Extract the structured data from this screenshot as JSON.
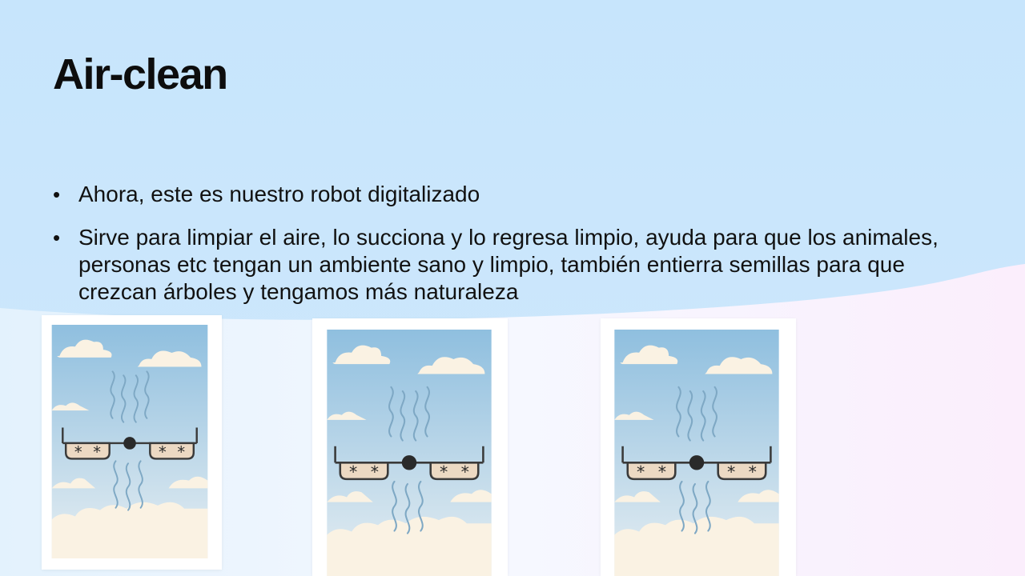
{
  "slide": {
    "title": "Air-clean",
    "bullets": [
      {
        "text": "Ahora, este es nuestro robot digitalizado"
      },
      {
        "text": "Sirve para limpiar el aire, lo succiona y lo regresa limpio, ayuda para que los animales, personas etc tengan un ambiente sano y limpio, también entierra semillas para que crezcan árboles y tengamos más naturaleza"
      }
    ],
    "bullet_glyph": "•"
  },
  "images": [
    {
      "name": "air-clean-robot-illustration-1",
      "subject": "robot drone with fans cleaning air under a cloudy sky"
    },
    {
      "name": "air-clean-robot-illustration-2",
      "subject": "robot drone with fans cleaning air under a cloudy sky"
    },
    {
      "name": "air-clean-robot-illustration-3",
      "subject": "robot drone with fans cleaning air under a cloudy sky"
    }
  ],
  "colors": {
    "sky_top": "#8fbfdf",
    "sky_bottom": "#e6eef2",
    "cloud": "#faf2e3",
    "robot_body": "#ecd9c3",
    "robot_outline": "#3a3a3a",
    "air_lines": "#7ea8c4"
  }
}
